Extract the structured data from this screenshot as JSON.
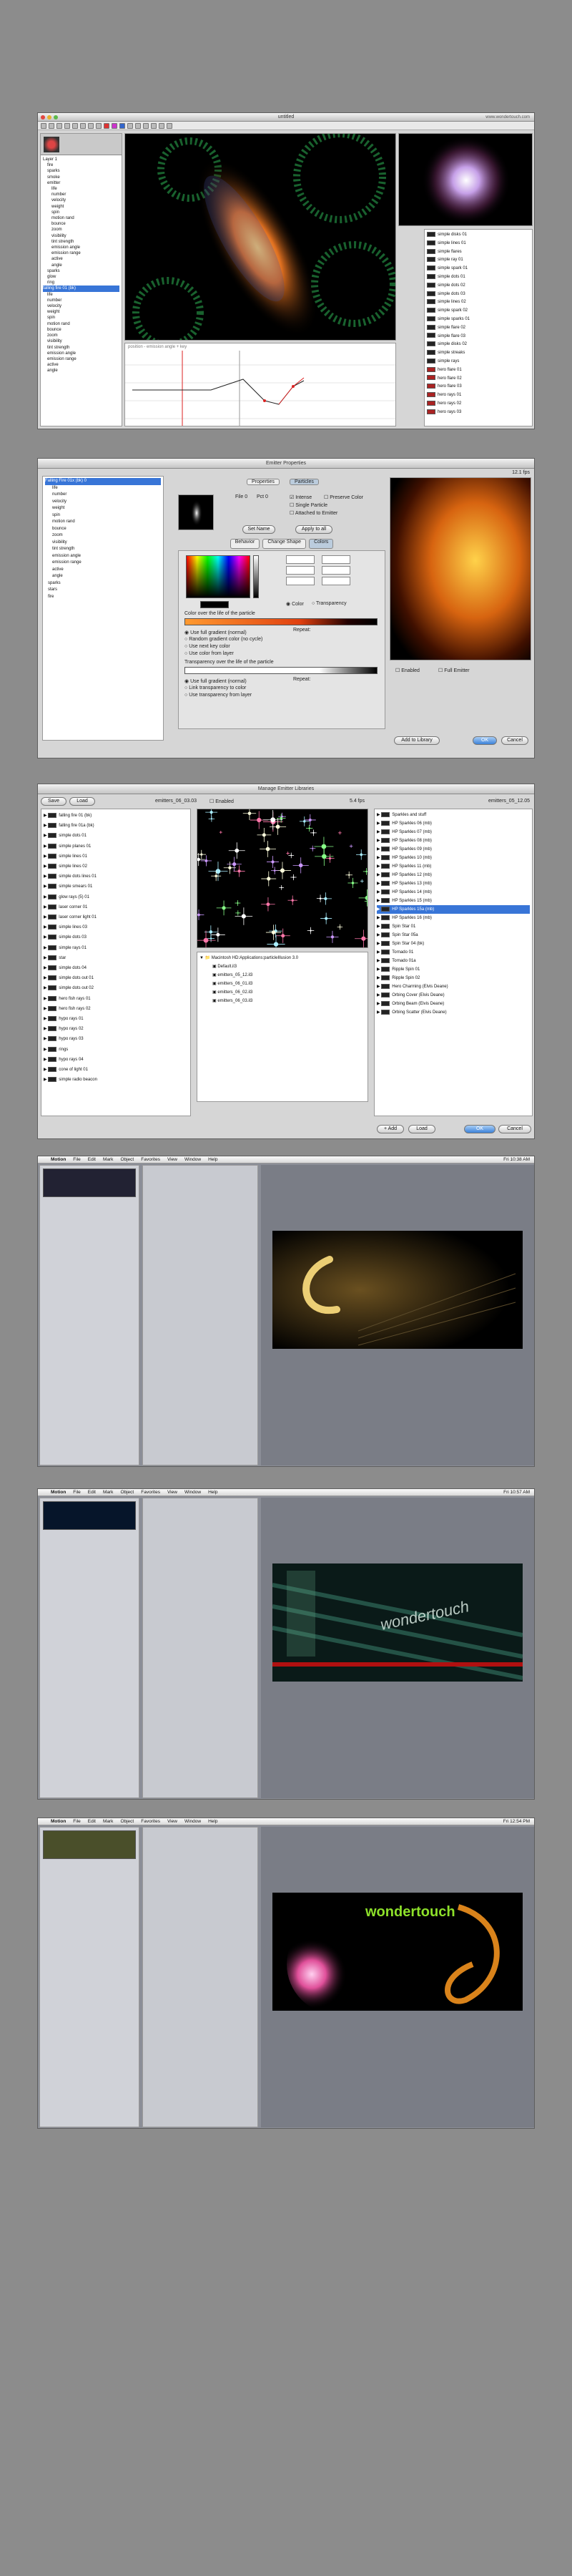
{
  "screens": [
    {
      "title": "untitled",
      "url_text": "www.wondertouch.com",
      "tree_left": [
        "Layer 1",
        "fire",
        "sparks",
        "smoke",
        "emitter",
        "life",
        "number",
        "velocity",
        "weight",
        "spin",
        "motion rand",
        "bounce",
        "zoom",
        "visibility",
        "tint strength",
        "emission angle",
        "emission range",
        "active",
        "angle",
        "sparks",
        "glow",
        "ring"
      ],
      "tree_left_2": [
        "falling fire 01 (bk)",
        "life",
        "number",
        "velocity",
        "weight",
        "spin",
        "motion rand",
        "bounce",
        "zoom",
        "visibility",
        "tint strength",
        "emission angle",
        "emission range",
        "active",
        "angle"
      ],
      "library_right": [
        "simple disks 01",
        "simple lines 01",
        "simple flares",
        "simple ray 01",
        "simple spark 01",
        "simple dots 01",
        "simple dots 02",
        "simple dots 03",
        "simple lines 02",
        "simple spark 02",
        "simple sparks 01",
        "simple flare 02",
        "simple flare 03",
        "simple disks 02",
        "simple streaks",
        "simple rays",
        "hero flare 01",
        "hero flare 02",
        "hero flare 03",
        "hero rays 01",
        "hero rays 02",
        "hero rays 03"
      ],
      "graph_header": "position - emission angle + key"
    },
    {
      "title": "Emitter Properties",
      "version": "12.1 fps",
      "tree": [
        "Falling Fire 01x (bk) 0",
        "life",
        "number",
        "velocity",
        "weight",
        "spin",
        "motion rand",
        "bounce",
        "zoom",
        "visibility",
        "tint strength",
        "emission angle",
        "emission range",
        "active",
        "angle",
        "sparks",
        "stars",
        "fire"
      ],
      "tabs": [
        "Properties",
        "Particles"
      ],
      "sub_tabs": [
        "Behavior",
        "Change Shape",
        "Colors"
      ],
      "checks": [
        "Intense",
        "Preserve Color",
        "Single Particle",
        "Attached to Emitter"
      ],
      "file_label": "File 0",
      "pct_label": "Pct 0",
      "buttons": {
        "set_name": "Set Name",
        "apply": "Apply to all",
        "add_library": "Add to Library",
        "ok": "OK",
        "cancel": "Cancel"
      },
      "checkbox_enabled": "Enabled",
      "checkbox_full": "Full Emitter",
      "color_label": "Color over the life of the particle",
      "transparency_label": "Transparency over the life of the particle",
      "repeat": "Repeat:",
      "color_options": [
        "Use full gradient (normal)",
        "Random gradient color (no cycle)",
        "Use next key color",
        "Use color from layer"
      ],
      "trans_options": [
        "Use full gradient (normal)",
        "Link transparency to color",
        "Use transparency from layer"
      ],
      "radio_color": "Color",
      "radio_trans": "Transparency"
    },
    {
      "title": "Manage Emitter Libraries",
      "save": "Save",
      "load": "Load",
      "file_left": "emitters_06_03.03",
      "enabled": "Enabled",
      "fps": "5.4 fps",
      "file_right": "emitters_05_12.05",
      "left_list": [
        "falling fire 01 (bk)",
        "falling fire 01a (bk)",
        "simple dots 01",
        "simple planes 01",
        "simple lines 01",
        "simple lines 02",
        "simple dots lines 01",
        "simple smears 01",
        "glow rays (5) 01",
        "laser corner 01",
        "laser corner light 01",
        "simple lines 03",
        "simple dots 03",
        "simple rays 01",
        "star",
        "simple dots 04",
        "simple dots out 01",
        "simple dots out 02",
        "hero fish rays 01",
        "hero fish rays 02",
        "hypo rays 01",
        "hypo rays 02",
        "hypo rays 03",
        "rings",
        "hypo rays 04",
        "cone of light 01",
        "simple radio beacon"
      ],
      "folder_mid": "Macintosh HD:Applications:particleIllusion 3.0",
      "mid_files": [
        "Default.il3",
        "emitters_05_12.il3",
        "emitters_06_01.il3",
        "emitters_06_02.il3",
        "emitters_06_03.il3"
      ],
      "right_list": [
        "Sparkles and stuff",
        "HP Sparkles 06 (mb)",
        "HP Sparkles 07 (mb)",
        "HP Sparkles 08 (mb)",
        "HP Sparkles 09 (mb)",
        "HP Sparkles 10 (mb)",
        "HP Sparkles 11 (mb)",
        "HP Sparkles 12 (mb)",
        "HP Sparkles 13 (mb)",
        "HP Sparkles 14 (mb)",
        "HP Sparkles 15 (mb)",
        "HP Sparkles 15a (mb)",
        "HP Sparkles 16 (mb)",
        "Spin Star 01",
        "Spin Star 05a",
        "Spin Star 04 (bk)",
        "Tornado 01",
        "Tornado 01a",
        "Ripple Spin 01",
        "Ripple Spin 02",
        "Hero Charming (Elvis Deane)",
        "Orbing Cover (Elvis Deane)",
        "Orbing Beam (Elvis Deane)",
        "Orbing Scatter (Elvis Deane)"
      ],
      "buttons": {
        "add": "+ Add",
        "load": "Load",
        "ok": "OK",
        "cancel": "Cancel"
      }
    },
    {
      "menu": [
        "Motion",
        "File",
        "Edit",
        "Mark",
        "Object",
        "Favorites",
        "View",
        "Window",
        "Help"
      ],
      "clock": "Fri 10:38 AM",
      "canvas_text": ""
    },
    {
      "menu": [
        "Motion",
        "File",
        "Edit",
        "Mark",
        "Object",
        "Favorites",
        "View",
        "Window",
        "Help"
      ],
      "clock": "Fri 10:57 AM",
      "canvas_text": "wondertouch"
    },
    {
      "menu": [
        "Motion",
        "File",
        "Edit",
        "Mark",
        "Object",
        "Favorites",
        "View",
        "Window",
        "Help"
      ],
      "clock": "Fri 12:54 PM",
      "canvas_text": "wondertouch"
    }
  ],
  "colors": {
    "page_bg": "#8c8c8c",
    "selection": "#3875d7",
    "aqua": "#3c82d9",
    "fcp_grey": "#6c6f78"
  }
}
